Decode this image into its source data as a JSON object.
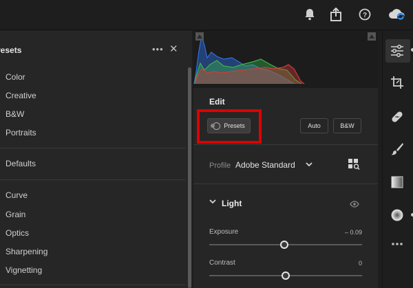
{
  "topbar": {
    "icons": [
      "notification-bell-icon",
      "share-icon",
      "help-icon",
      "creative-cloud-icon"
    ]
  },
  "presets_panel": {
    "title": "resets",
    "more_label": "•••",
    "close_label": "✕",
    "items": [
      "Color",
      "Creative",
      "B&W",
      "Portraits",
      "Defaults",
      "Curve",
      "Grain",
      "Optics",
      "Sharpening",
      "Vignetting"
    ]
  },
  "edit": {
    "title": "Edit",
    "presets_button": "Presets",
    "auto_button": "Auto",
    "bw_button": "B&W",
    "profile_label": "Profile",
    "profile_value": "Adobe Standard",
    "light_section": "Light",
    "sliders": [
      {
        "label": "Exposure",
        "value": "– 0.09",
        "position": 0.49
      },
      {
        "label": "Contrast",
        "value": "0",
        "position": 0.5
      }
    ]
  },
  "rail": {
    "icons": [
      "edit-sliders-icon",
      "crop-icon",
      "healing-icon",
      "brush-icon",
      "linear-gradient-icon",
      "radial-gradient-icon",
      "more-icon"
    ]
  },
  "colors": {
    "highlight": "#e00000",
    "histogram_red": "#d33a3a",
    "histogram_green": "#3bb34a",
    "histogram_blue": "#2f6fe0"
  }
}
